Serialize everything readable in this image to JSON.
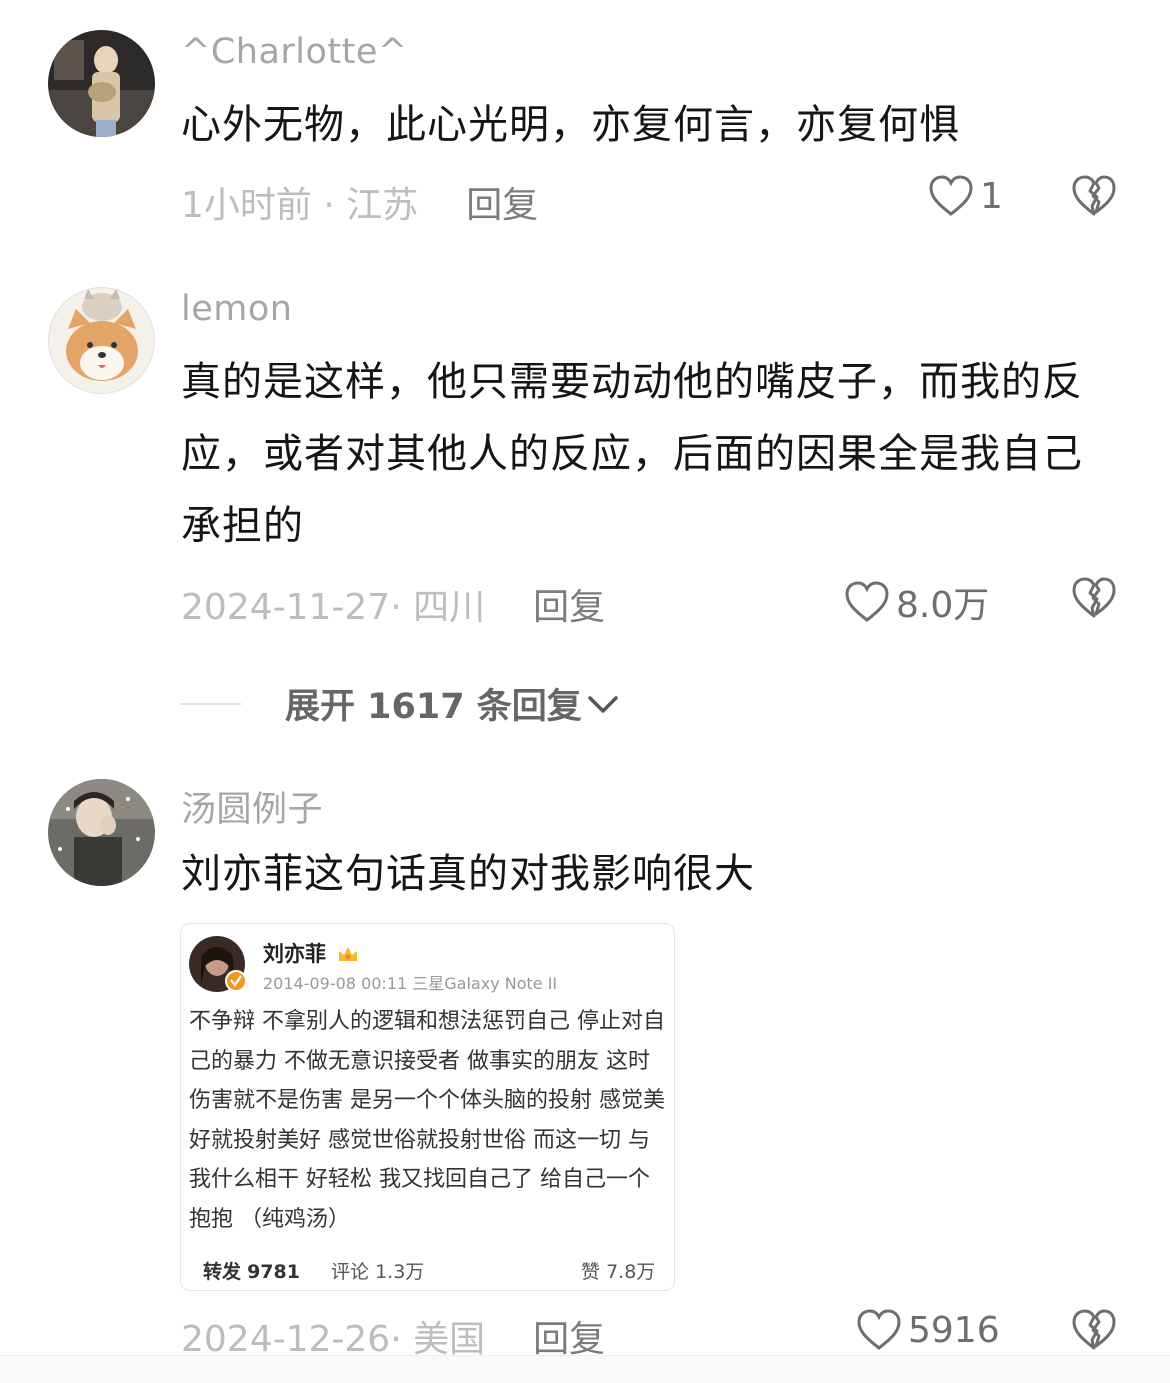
{
  "comments": [
    {
      "username": "^Charlotte^",
      "content": "心外无物，此心光明，亦复何言，亦复何惧",
      "time_location": "1小时前 · 江苏",
      "reply": "回复",
      "likes": "1"
    },
    {
      "username": "lemon",
      "content": "真的是这样，他只需要动动他的嘴皮子，而我的反应，或者对其他人的反应，后面的因果全是我自己承担的",
      "time_location": "2024-11-27· 四川",
      "reply": "回复",
      "likes": "8.0万"
    },
    {
      "username": "汤圆例子",
      "content": "刘亦菲这句话真的对我影响很大",
      "time_location": "2024-12-26· 美国",
      "reply": "回复",
      "likes": "5916"
    }
  ],
  "expand": {
    "label": "展开 1617 条回复"
  },
  "embedded_post": {
    "author": "刘亦菲",
    "meta": "2014-09-08 00:11  三星Galaxy Note II",
    "text": "不争辩 不拿别人的逻辑和想法惩罚自己 停止对自己的暴力 不做无意识接受者 做事实的朋友 这时伤害就不是伤害 是另一个个体头脑的投射 感觉美好就投射美好 感觉世俗就投射世俗 而这一切 与我什么相干 好轻松 我又找回自己了 给自己一个抱抱 （纯鸡汤）",
    "repost_label": "转发",
    "repost_count": "9781",
    "comment_label": "评论",
    "comment_count": "1.3万",
    "like_label": "赞",
    "like_count": "7.8万"
  },
  "colors": {
    "username": "#a6a6a6",
    "meta": "#bdbdbd",
    "reply": "#7c7c7c",
    "content": "#151515"
  },
  "icons": [
    "heart-outline-icon",
    "broken-heart-icon",
    "chevron-down-icon",
    "crown-icon",
    "verified-badge-icon"
  ]
}
